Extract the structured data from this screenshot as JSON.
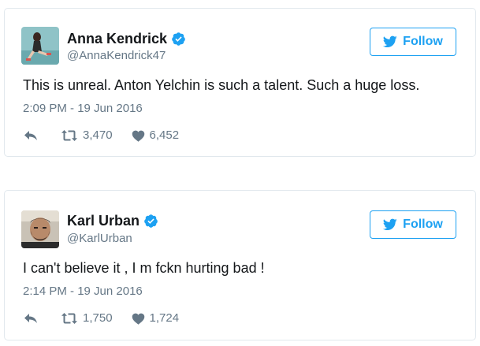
{
  "tweets": [
    {
      "display_name": "Anna Kendrick",
      "handle": "@AnnaKendrick47",
      "follow_label": "Follow",
      "text": "This is unreal. Anton Yelchin is such a talent. Such a huge loss.",
      "timestamp": "2:09 PM - 19 Jun 2016",
      "retweets": "3,470",
      "likes": "6,452",
      "verified": true
    },
    {
      "display_name": "Karl Urban",
      "handle": "@KarlUrban",
      "follow_label": "Follow",
      "text": "I can't believe it , I m fckn hurting bad !",
      "timestamp": "2:14 PM - 19 Jun 2016",
      "retweets": "1,750",
      "likes": "1,724",
      "verified": true
    }
  ],
  "colors": {
    "accent": "#1da1f2",
    "muted": "#657786",
    "border": "#e1e8ed",
    "text": "#14171a"
  },
  "icons": [
    "verified-badge-icon",
    "twitter-bird-icon",
    "reply-icon",
    "retweet-icon",
    "heart-icon"
  ]
}
